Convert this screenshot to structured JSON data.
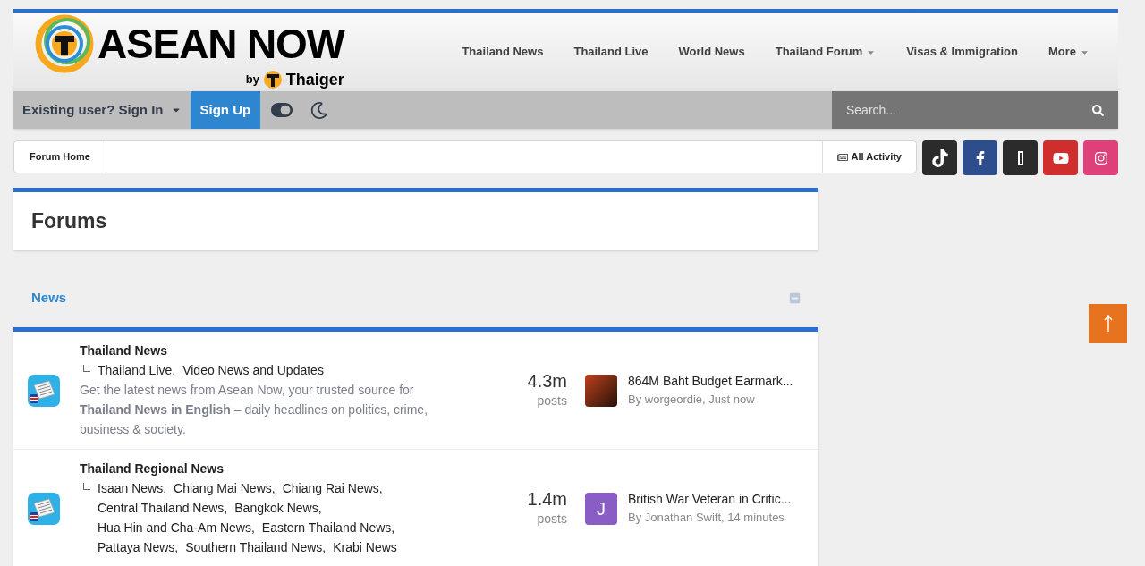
{
  "header": {
    "logo": {
      "name": "ASEAN NOW",
      "by": "by",
      "brand": "Thaiger"
    },
    "nav": [
      {
        "label": "Thailand News",
        "has_dropdown": false
      },
      {
        "label": "Thailand Live",
        "has_dropdown": false
      },
      {
        "label": "World News",
        "has_dropdown": false
      },
      {
        "label": "Thailand Forum",
        "has_dropdown": true
      },
      {
        "label": "Visas & Immigration",
        "has_dropdown": false
      },
      {
        "label": "More",
        "has_dropdown": true
      }
    ]
  },
  "user_bar": {
    "sign_in": "Existing user? Sign In",
    "sign_up": "Sign Up",
    "search": {
      "placeholder": "Search..."
    }
  },
  "breadcrumb": {
    "items": [
      "Forum Home"
    ],
    "all_activity": "All Activity"
  },
  "social": [
    {
      "kind": "tiktok",
      "color": "#2b2b2b"
    },
    {
      "kind": "facebook",
      "color": "#2d4d8c"
    },
    {
      "kind": "other",
      "color": "#2b2b2b"
    },
    {
      "kind": "youtube",
      "color": "#d02d2d"
    },
    {
      "kind": "instagram",
      "color": "#e0407a"
    }
  ],
  "page_title": "Forums",
  "category": {
    "title": "News",
    "expanded": true
  },
  "forums": [
    {
      "title": "Thailand News",
      "subforums": [
        "Thailand Live,",
        "Video News and Updates"
      ],
      "description": "Get the latest news from Asean Now, your trusted source for **Thailand News in English** – daily headlines on politics, crime, business & society.",
      "count": "4.3m",
      "count_label": "posts",
      "last_post": {
        "title": "864M Baht Budget Earmark...",
        "byline": "By worgeordie, Just now",
        "avatar": {
          "kind": "photo"
        }
      }
    },
    {
      "title": "Thailand Regional News",
      "subforums": [
        "Isaan News,",
        "Chiang Mai News,",
        "Chiang Rai News,",
        "Central Thailand News,",
        "Bangkok News,",
        "Hua Hin and Cha-Am News,",
        "Eastern Thailand News,",
        "Pattaya News,",
        "Southern Thailand News,",
        "Krabi News"
      ],
      "count": "1.4m",
      "count_label": "posts",
      "last_post": {
        "title": "British War Veteran in Critic...",
        "byline": "By Jonathan Swift, 14 minutes",
        "avatar": {
          "kind": "letter",
          "letter": "J",
          "color": "#8a5cc6"
        }
      }
    }
  ]
}
